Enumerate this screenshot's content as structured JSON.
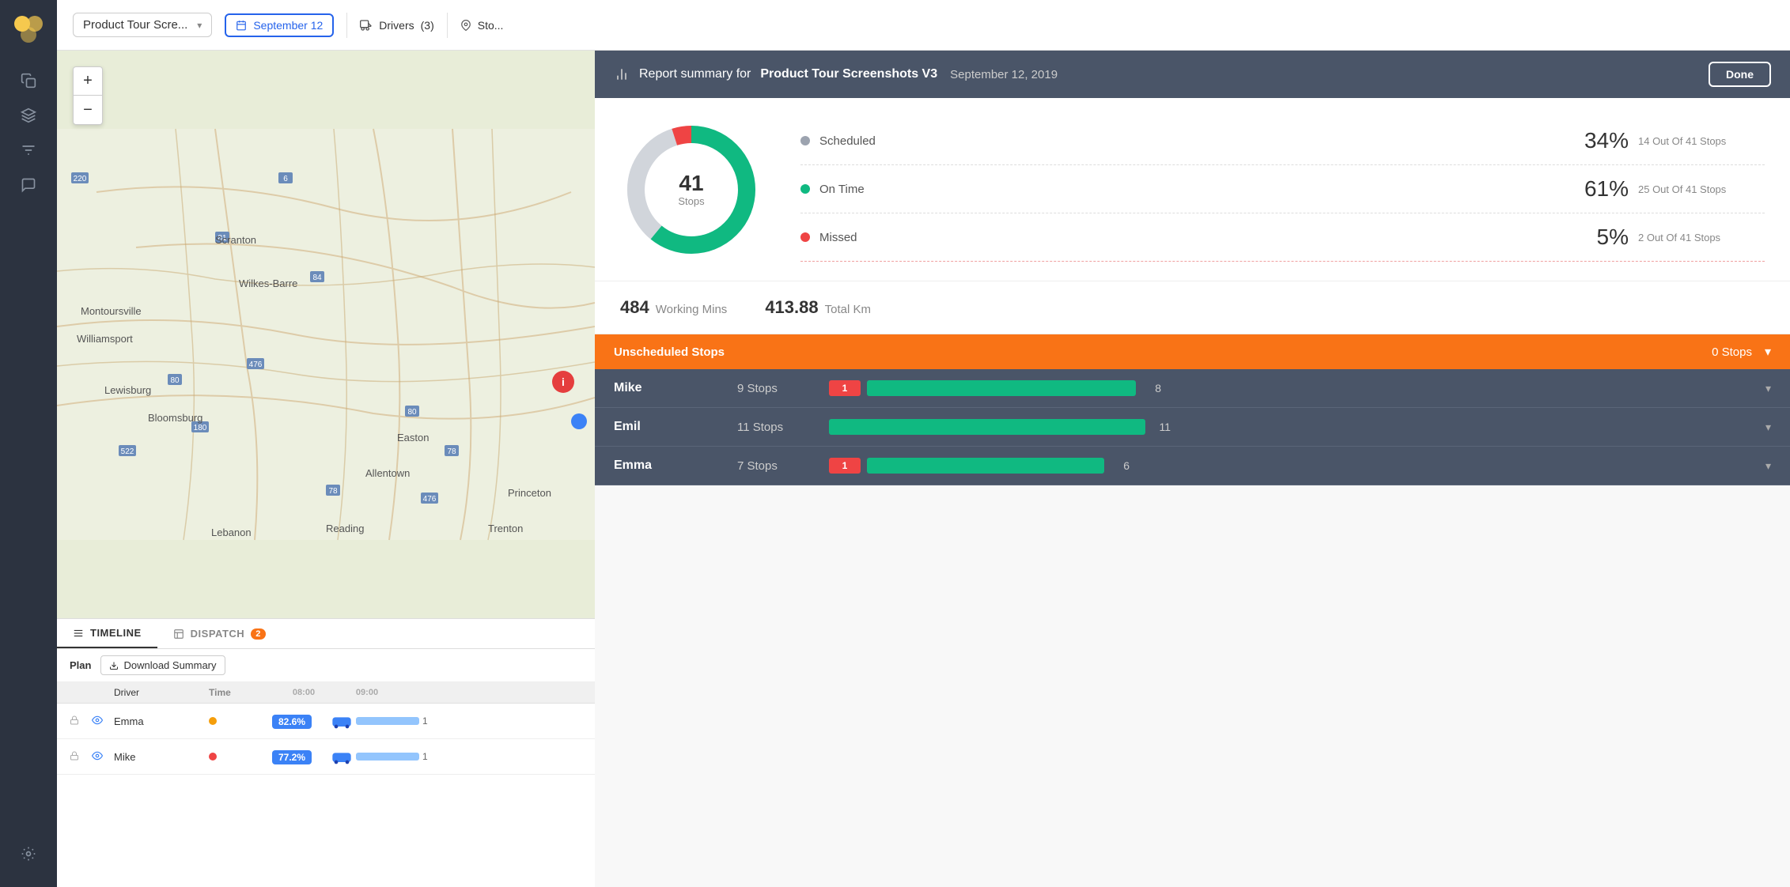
{
  "app": {
    "logo": "🟡"
  },
  "topbar": {
    "route_name": "Product Tour Scre...",
    "date_label": "September 12",
    "drivers_label": "Drivers",
    "drivers_count": "(3)",
    "stops_label": "Sto..."
  },
  "sidebar": {
    "icons": [
      "copy-icon",
      "layers-icon",
      "filter-icon",
      "message-icon",
      "settings-icon"
    ]
  },
  "map": {
    "zoom_in": "+",
    "zoom_out": "−"
  },
  "bottom_panel": {
    "tabs": [
      {
        "id": "timeline",
        "label": "TIMELINE",
        "active": true,
        "badge": null
      },
      {
        "id": "dispatch",
        "label": "DISPATCH",
        "active": false,
        "badge": "2"
      }
    ],
    "plan_label": "Plan",
    "download_label": "Download Summary",
    "table": {
      "columns": [
        "",
        "",
        "Driver",
        "Time",
        "08:00",
        "09:00"
      ],
      "rows": [
        {
          "name": "Emma",
          "dot_color": "#f59e0b",
          "score": "82.6%",
          "locked": true,
          "visible": true
        },
        {
          "name": "Mike",
          "dot_color": "#ef4444",
          "score": "77.2%",
          "locked": true,
          "visible": true
        }
      ]
    }
  },
  "report": {
    "prefix": "Report summary for",
    "title_bold": "Product Tour Screenshots V3",
    "date": "September 12, 2019",
    "done_label": "Done",
    "donut": {
      "total": 41,
      "total_label": "Stops",
      "segments": [
        {
          "name": "Scheduled",
          "color": "#9ca3af",
          "pct": 34,
          "deg": 122
        },
        {
          "name": "On Time",
          "color": "#10b981",
          "pct": 61,
          "deg": 220
        },
        {
          "name": "Missed",
          "color": "#ef4444",
          "pct": 5,
          "deg": 18
        }
      ]
    },
    "stats": [
      {
        "name": "Scheduled",
        "color": "#9ca3af",
        "pct": "34%",
        "desc": "14 Out Of 41 Stops"
      },
      {
        "name": "On Time",
        "color": "#10b981",
        "pct": "61%",
        "desc": "25 Out Of 41 Stops"
      },
      {
        "name": "Missed",
        "color": "#ef4444",
        "pct": "5%",
        "desc": "2 Out Of 41 Stops"
      }
    ],
    "working_mins": "484",
    "working_mins_label": "Working Mins",
    "total_km": "413.88",
    "total_km_label": "Total Km",
    "unscheduled_label": "Unscheduled Stops",
    "unscheduled_count": "0 Stops",
    "drivers": [
      {
        "name": "Mike",
        "stops": "9 Stops",
        "missed": 1,
        "ontime": 8,
        "ontime_pct": 88
      },
      {
        "name": "Emil",
        "stops": "11 Stops",
        "missed": 0,
        "ontime": 11,
        "ontime_pct": 100
      },
      {
        "name": "Emma",
        "stops": "7 Stops",
        "missed": 1,
        "ontime": 6,
        "ontime_pct": 85
      }
    ]
  }
}
